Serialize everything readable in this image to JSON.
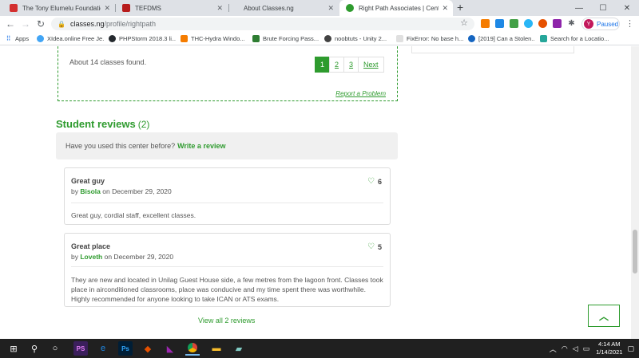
{
  "browser": {
    "tabs": [
      {
        "title": "The Tony Elumelu Foundation - E",
        "active": false
      },
      {
        "title": "TEFDMS",
        "active": false
      },
      {
        "title": "About Classes.ng",
        "active": false
      },
      {
        "title": "Right Path Associates | Center in",
        "active": true
      }
    ],
    "address": {
      "host": "classes.ng",
      "path": "/profile/rightpath"
    },
    "profile": {
      "initial": "Y",
      "status": "Paused"
    },
    "bookmarks": [
      {
        "label": "Apps"
      },
      {
        "label": "XIdea.online Free Je..."
      },
      {
        "label": "PHPStorm 2018.3 li..."
      },
      {
        "label": "THC-Hydra Windo..."
      },
      {
        "label": "Brute Forcing Pass..."
      },
      {
        "label": "noobtuts - Unity 2..."
      },
      {
        "label": "FixError: No base h..."
      },
      {
        "label": "[2019] Can a Stolen..."
      },
      {
        "label": "Search for a Locatio..."
      }
    ]
  },
  "results": {
    "count_text": "About 14 classes found.",
    "pages": [
      "1",
      "2",
      "3",
      "Next"
    ],
    "report_link": "Report a Problem"
  },
  "reviews": {
    "heading": "Student reviews",
    "count": "(2)",
    "prompt": "Have you used this center before?",
    "write_link": "Write a review",
    "items": [
      {
        "title": "Great guy",
        "by": "by",
        "author": "Bisola",
        "date": "on December 29, 2020",
        "likes": "6",
        "body": "Great guy, cordial staff, excellent classes."
      },
      {
        "title": "Great place",
        "by": "by",
        "author": "Loveth",
        "date": "on December 29, 2020",
        "likes": "5",
        "body": "They are new and located in Unilag Guest House side, a few metres from the lagoon front. Classes took place in airconditioned classrooms, place was conducive and my time spent there was worthwhile. Highly recommended for anyone looking to take ICAN or ATS exams."
      }
    ],
    "view_all": "View all 2 reviews"
  },
  "taskbar": {
    "time": "4:14 AM",
    "date": "1/14/2021"
  },
  "colors": {
    "accent": "#2e9b2e",
    "tabstrip": "#dee1e6",
    "taskbar": "#202020"
  }
}
